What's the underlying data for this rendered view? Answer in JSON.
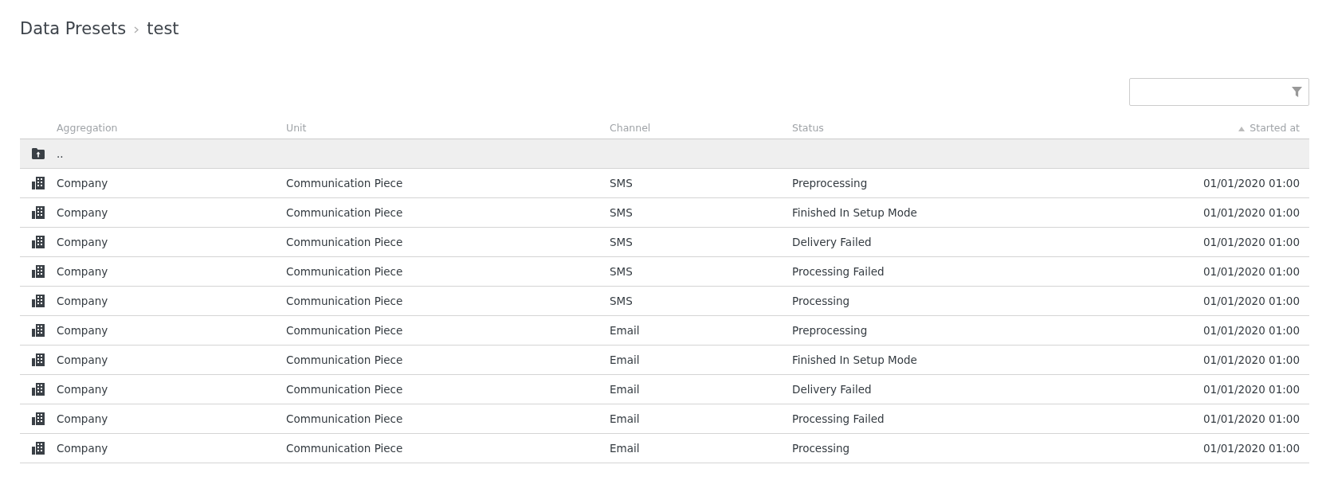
{
  "breadcrumb": [
    {
      "label": "Data Presets"
    },
    {
      "label": "test"
    }
  ],
  "table": {
    "columns": [
      {
        "label": "Aggregation",
        "sorted": false
      },
      {
        "label": "Unit",
        "sorted": false
      },
      {
        "label": "Channel",
        "sorted": false
      },
      {
        "label": "Status",
        "sorted": false
      },
      {
        "label": "Started at",
        "sorted": true
      }
    ],
    "rows": [
      {
        "kind": "parent",
        "cells": [
          ".."
        ]
      },
      {
        "kind": "company",
        "cells": [
          "Company",
          "Communication Piece",
          "SMS",
          "Preprocessing",
          "01/01/2020 01:00"
        ]
      },
      {
        "kind": "company",
        "cells": [
          "Company",
          "Communication Piece",
          "SMS",
          "Finished In Setup Mode",
          "01/01/2020 01:00"
        ]
      },
      {
        "kind": "company",
        "cells": [
          "Company",
          "Communication Piece",
          "SMS",
          "Delivery Failed",
          "01/01/2020 01:00"
        ]
      },
      {
        "kind": "company",
        "cells": [
          "Company",
          "Communication Piece",
          "SMS",
          "Processing Failed",
          "01/01/2020 01:00"
        ]
      },
      {
        "kind": "company",
        "cells": [
          "Company",
          "Communication Piece",
          "SMS",
          "Processing",
          "01/01/2020 01:00"
        ]
      },
      {
        "kind": "company",
        "cells": [
          "Company",
          "Communication Piece",
          "Email",
          "Preprocessing",
          "01/01/2020 01:00"
        ]
      },
      {
        "kind": "company",
        "cells": [
          "Company",
          "Communication Piece",
          "Email",
          "Finished In Setup Mode",
          "01/01/2020 01:00"
        ]
      },
      {
        "kind": "company",
        "cells": [
          "Company",
          "Communication Piece",
          "Email",
          "Delivery Failed",
          "01/01/2020 01:00"
        ]
      },
      {
        "kind": "company",
        "cells": [
          "Company",
          "Communication Piece",
          "Email",
          "Processing Failed",
          "01/01/2020 01:00"
        ]
      },
      {
        "kind": "company",
        "cells": [
          "Company",
          "Communication Piece",
          "Email",
          "Processing",
          "01/01/2020 01:00"
        ]
      }
    ]
  }
}
